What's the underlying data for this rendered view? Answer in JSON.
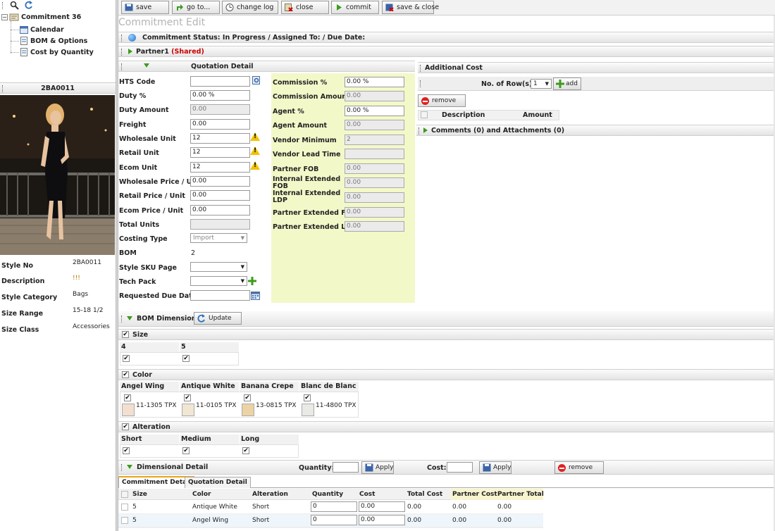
{
  "tree": {
    "root": "Commitment 36",
    "children": [
      "Calendar",
      "BOM & Options",
      "Cost by Quantity"
    ]
  },
  "style_panel": {
    "header": "2BA0011",
    "fields": [
      {
        "label": "Style No",
        "value": "2BA0011"
      },
      {
        "label": "Description",
        "value": "!!!"
      },
      {
        "label": "Style Category",
        "value": "Bags"
      },
      {
        "label": "Size Range",
        "value": "15-18 1/2"
      },
      {
        "label": "Size Class",
        "value": "Accessories"
      }
    ]
  },
  "toolbar": {
    "save": "save",
    "goto": "go to...",
    "change_log": "change log",
    "close": "close",
    "commit": "commit",
    "save_close": "save & close"
  },
  "page_title": "Commitment Edit",
  "status": "Commitment Status: In Progress / Assigned To: / Due Date:",
  "partner": {
    "name": "Partner1",
    "tag": "(Shared)"
  },
  "quotation": {
    "header": "Quotation Detail",
    "left_fields": [
      {
        "label": "HTS Code",
        "value": ""
      },
      {
        "label": "Duty %",
        "value": "0.00 %"
      },
      {
        "label": "Duty Amount",
        "value": "0.00"
      },
      {
        "label": "Freight",
        "value": "0.00"
      },
      {
        "label": "Wholesale Unit",
        "value": "12"
      },
      {
        "label": "Retail Unit",
        "value": "12"
      },
      {
        "label": "Ecom Unit",
        "value": "12"
      },
      {
        "label": "Wholesale Price / Unit",
        "value": "0.00"
      },
      {
        "label": "Retail Price / Unit",
        "value": "0.00"
      },
      {
        "label": "Ecom Price / Unit",
        "value": "0.00"
      },
      {
        "label": "Total Units",
        "value": ""
      },
      {
        "label": "Costing Type",
        "value": "Import"
      },
      {
        "label": "BOM",
        "value": "2"
      },
      {
        "label": "Style SKU Page",
        "value": ""
      },
      {
        "label": "Tech Pack",
        "value": ""
      },
      {
        "label": "Requested Due Date",
        "value": ""
      }
    ],
    "right_fields": [
      {
        "label": "Commission %",
        "value": "0.00 %"
      },
      {
        "label": "Commission Amount",
        "value": "0.00"
      },
      {
        "label": "Agent %",
        "value": "0.00 %"
      },
      {
        "label": "Agent Amount",
        "value": "0.00"
      },
      {
        "label": "Vendor Minimum",
        "value": "2"
      },
      {
        "label": "Vendor Lead Time",
        "value": ""
      },
      {
        "label": "Partner FOB",
        "value": "0.00"
      },
      {
        "label": "Internal Extended FOB",
        "value": "0.00"
      },
      {
        "label": "Internal Extended LDP",
        "value": "0.00"
      },
      {
        "label": "Partner Extended FOB",
        "value": "0.00"
      },
      {
        "label": "Partner Extended LDP",
        "value": "0.00"
      }
    ]
  },
  "additional_cost": {
    "header": "Additional Cost",
    "rows_label": "No. of Row(s):",
    "rows_value": "1",
    "add": "add",
    "remove": "remove",
    "col_description": "Description",
    "col_amount": "Amount"
  },
  "comments": "Comments (0) and Attachments (0)",
  "bom_dimensions": {
    "header": "BOM Dimensions",
    "update": "Update",
    "size": {
      "header": "Size",
      "values": [
        "4",
        "5"
      ]
    },
    "color": {
      "header": "Color",
      "values": [
        {
          "name": "Angel Wing",
          "code": "11-1305 TPX",
          "swatch": "#f3dfd0"
        },
        {
          "name": "Antique White",
          "code": "11-0105 TPX",
          "swatch": "#f1e6d3"
        },
        {
          "name": "Banana Crepe",
          "code": "13-0815 TPX",
          "swatch": "#ecd3a6"
        },
        {
          "name": "Blanc de Blanc",
          "code": "11-4800 TPX",
          "swatch": "#e9e9e6"
        }
      ]
    },
    "alteration": {
      "header": "Alteration",
      "values": [
        "Short",
        "Medium",
        "Long"
      ]
    }
  },
  "dimensional": {
    "header": "Dimensional Detail",
    "quantity_label": "Quantity:",
    "cost_label": "Cost:",
    "apply": "Apply",
    "remove": "remove",
    "tabs": [
      "Commitment Detail",
      "Quotation Detail"
    ],
    "columns": [
      "Size",
      "Color",
      "Alteration",
      "Quantity",
      "Cost",
      "Total Cost",
      "Partner Cost",
      "Partner Total"
    ],
    "rows": [
      {
        "size": "5",
        "color": "Antique White",
        "alteration": "Short",
        "quantity": "0",
        "cost": "0.00",
        "total": "0.00",
        "pcost": "0.00",
        "ptotal": "0.00"
      },
      {
        "size": "5",
        "color": "Angel Wing",
        "alteration": "Short",
        "quantity": "0",
        "cost": "0.00",
        "total": "0.00",
        "pcost": "0.00",
        "ptotal": "0.00"
      }
    ]
  }
}
